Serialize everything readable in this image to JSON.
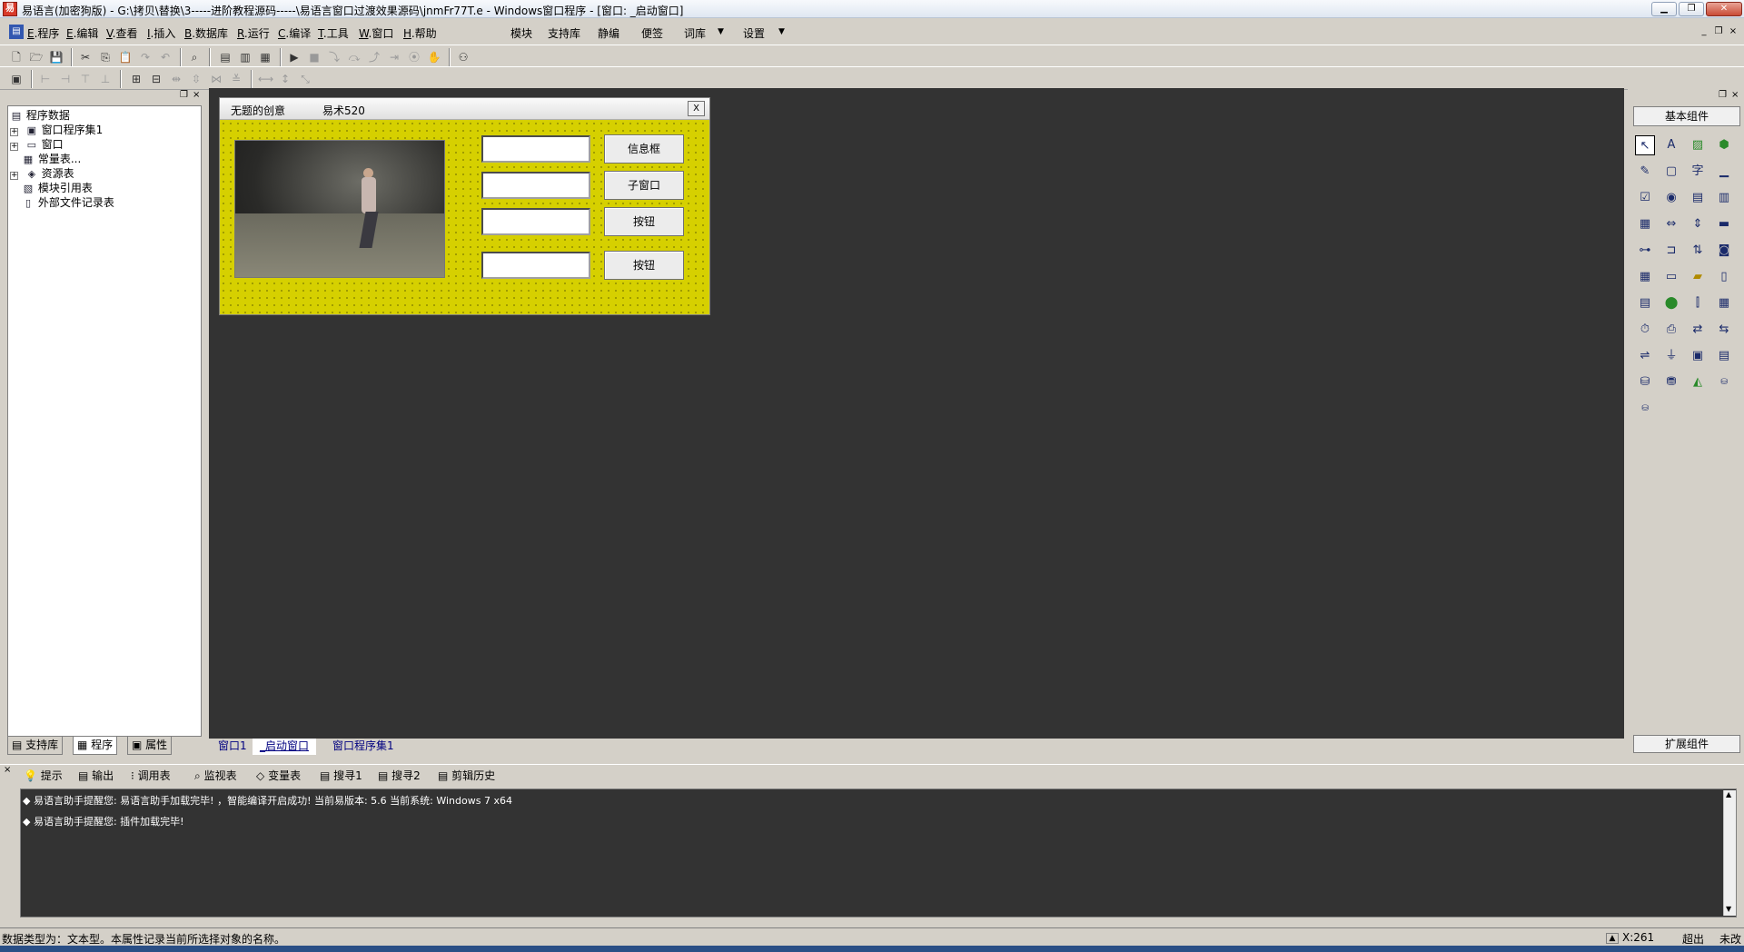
{
  "window": {
    "title": "易语言(加密狗版) - G:\\拷贝\\替换\\3-----进阶教程源码-----\\易语言窗口过渡效果源码\\jnmFr77T.e - Windows窗口程序 - [窗口: _启动窗口]",
    "app_icon": "易",
    "minimize": "▁",
    "restore": "❐",
    "close": "✕"
  },
  "menu": {
    "items": [
      {
        "key": "E",
        "label": ".程序"
      },
      {
        "key": "E",
        "label": ".编辑"
      },
      {
        "key": "V",
        "label": ".查看"
      },
      {
        "key": "I",
        "label": ".插入"
      },
      {
        "key": "B",
        "label": ".数据库"
      },
      {
        "key": "R",
        "label": ".运行"
      },
      {
        "key": "C",
        "label": ".编译"
      },
      {
        "key": "T",
        "label": ".工具"
      },
      {
        "key": "W",
        "label": ".窗口"
      },
      {
        "key": "H",
        "label": ".帮助"
      }
    ],
    "extra": [
      "模块",
      "支持库",
      "静编",
      "便签",
      "词库",
      "设置"
    ],
    "dropdown_arrow": "▼",
    "mdi_min": "_",
    "mdi_restore": "❐",
    "mdi_close": "×"
  },
  "left_panel": {
    "restore_glyph": "❐",
    "close_glyph": "×",
    "tree": [
      {
        "label": "程序数据",
        "icon": "▤",
        "level": 0,
        "expander": ""
      },
      {
        "label": "窗口程序集1",
        "icon": "▣",
        "level": 1,
        "expander": "+"
      },
      {
        "label": "窗口",
        "icon": "▭",
        "level": 1,
        "expander": "+"
      },
      {
        "label": "常量表...",
        "icon": "▦",
        "level": 1,
        "expander": ""
      },
      {
        "label": "资源表",
        "icon": "◈",
        "level": 1,
        "expander": "+"
      },
      {
        "label": "模块引用表",
        "icon": "▧",
        "level": 1,
        "expander": ""
      },
      {
        "label": "外部文件记录表",
        "icon": "▯",
        "level": 1,
        "expander": ""
      }
    ],
    "tabs": [
      {
        "label": "支持库",
        "icon": "▤"
      },
      {
        "label": "程序",
        "icon": "▦"
      },
      {
        "label": "属性",
        "icon": "▣"
      }
    ]
  },
  "designer": {
    "form_title_left": "无题的创意",
    "form_title_right": "易术520",
    "form_close": "X",
    "buttons": [
      "信息框",
      "子窗口",
      "按钮",
      "按钮"
    ],
    "tabs": [
      "窗口1",
      "_启动窗口",
      "窗口程序集1"
    ]
  },
  "toolbox": {
    "restore_glyph": "❐",
    "close_glyph": "×",
    "header": "基本组件",
    "footer": "扩展组件"
  },
  "output": {
    "close_glyph": "×",
    "tabs": [
      {
        "label": "提示",
        "icon": "💡"
      },
      {
        "label": "输出",
        "icon": "▤"
      },
      {
        "label": "调用表",
        "icon": "⁝"
      },
      {
        "label": "监视表",
        "icon": "⌕"
      },
      {
        "label": "变量表",
        "icon": "◇"
      },
      {
        "label": "搜寻1",
        "icon": "▤"
      },
      {
        "label": "搜寻2",
        "icon": "▤"
      },
      {
        "label": "剪辑历史",
        "icon": "▤"
      }
    ],
    "lines": [
      "◆ 易语言助手提醒您: 易语言助手加载完毕! ，智能编译开启成功! 当前易版本: 5.6  当前系统: Windows 7 x64",
      "◆ 易语言助手提醒您: 插件加载完毕!"
    ],
    "scroll_up": "▲",
    "scroll_down": "▼"
  },
  "status": {
    "text": "数据类型为：文本型。本属性记录当前所选择对象的名称。",
    "coord": "X:261",
    "mode": "超出",
    "extra": "未改",
    "up_glyph": "▲"
  }
}
